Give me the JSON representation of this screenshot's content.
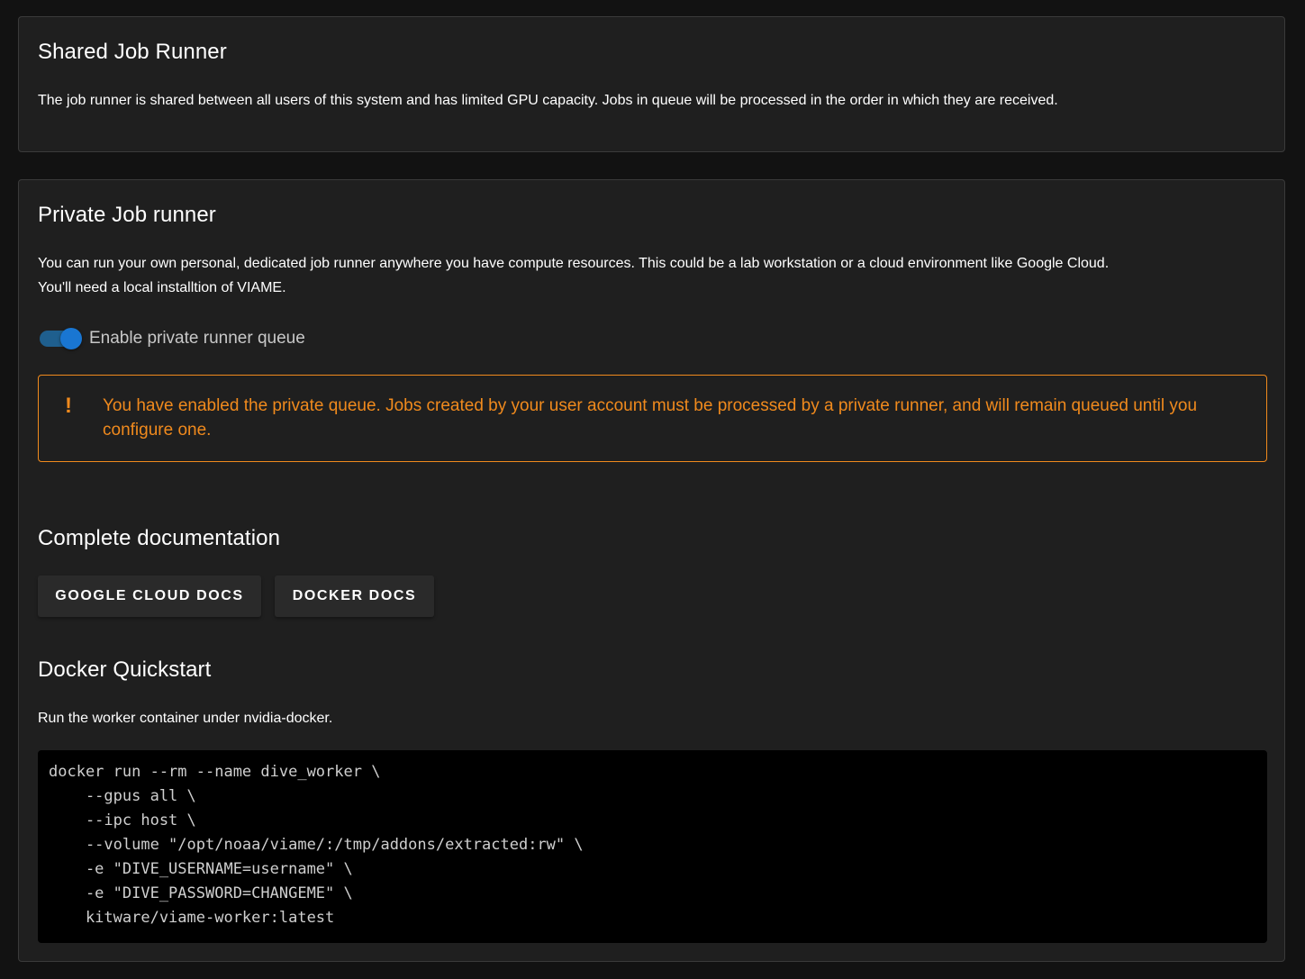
{
  "shared": {
    "title": "Shared Job Runner",
    "description": "The job runner is shared between all users of this system and has limited GPU capacity. Jobs in queue will be processed in the order in which they are received."
  },
  "private": {
    "title": "Private Job runner",
    "description_line1": "You can run your own personal, dedicated job runner anywhere you have compute resources. This could be a lab workstation or a cloud environment like Google Cloud.",
    "description_line2": "You'll need a local installtion of VIAME.",
    "toggle": {
      "label": "Enable private runner queue",
      "enabled": true,
      "color": "#1976d2"
    },
    "alert": {
      "icon": "exclamation-icon",
      "icon_glyph": "!",
      "text": "You have enabled the private queue. Jobs created by your user account must be processed by a private runner, and will remain queued until you configure one.",
      "color": "#f08a1d"
    },
    "docs": {
      "title": "Complete documentation",
      "google_cloud_label": "GOOGLE CLOUD DOCS",
      "docker_label": "DOCKER DOCS"
    },
    "quickstart": {
      "title": "Docker Quickstart",
      "description": "Run the worker container under nvidia-docker.",
      "code": "docker run --rm --name dive_worker \\\n    --gpus all \\\n    --ipc host \\\n    --volume \"/opt/noaa/viame/:/tmp/addons/extracted:rw\" \\\n    -e \"DIVE_USERNAME=username\" \\\n    -e \"DIVE_PASSWORD=CHANGEME\" \\\n    kitware/viame-worker:latest"
    }
  }
}
